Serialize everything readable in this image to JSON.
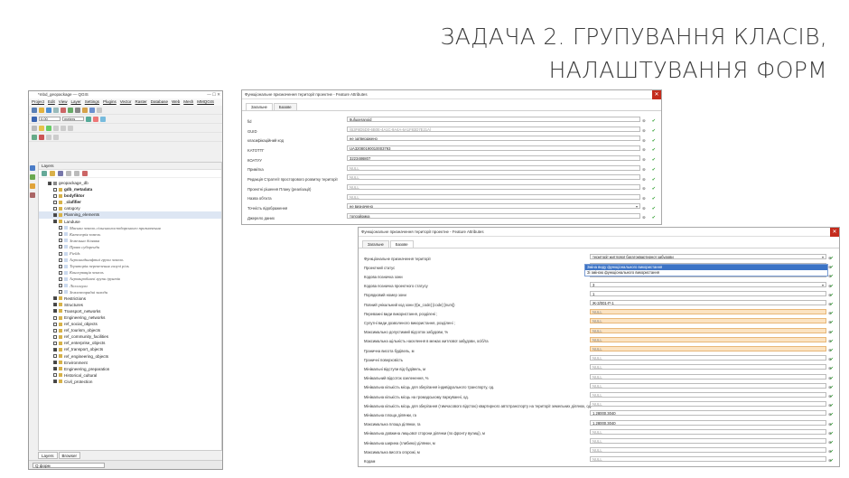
{
  "slide": {
    "title_line1": "ЗАДАЧА 2. ГРУПУВАННЯ КЛАСІВ,",
    "title_line2": "НАЛАШТУВАННЯ ФОРМ"
  },
  "qgis": {
    "window_title": "*mbd_geopackage — QGIS",
    "menu": [
      "Project",
      "Edit",
      "View",
      "Layer",
      "Settings",
      "Plugins",
      "Vector",
      "Raster",
      "Database",
      "Web",
      "Mesh",
      "MMQGIS"
    ],
    "scale_value": "0.00",
    "units_value": "meters",
    "layers_panel_title": "Layers",
    "tabs": [
      "Layers",
      "Browser"
    ],
    "search_placeholder": "Q  форм",
    "tree": [
      {
        "label": "geopackage_db",
        "indent": 1,
        "check": true,
        "style": ""
      },
      {
        "label": "gdb_metadata",
        "indent": 2,
        "check": false,
        "style": "bold"
      },
      {
        "label": "bodyfiktor",
        "indent": 2,
        "check": false,
        "style": "bold"
      },
      {
        "label": "_clafifier",
        "indent": 2,
        "check": false,
        "style": "bold"
      },
      {
        "label": "catogory",
        "indent": 2,
        "check": false,
        "style": ""
      },
      {
        "label": "Planning_elements",
        "indent": 2,
        "check": true,
        "style": "",
        "sel": true
      },
      {
        "label": "Landuse",
        "indent": 2,
        "check": true,
        "style": ""
      },
      {
        "label": "Масиви земель сільськогосподарського призначення",
        "indent": 3,
        "check": false,
        "style": "it"
      },
      {
        "label": "Категорія земель",
        "indent": 3,
        "check": false,
        "style": "it"
      },
      {
        "label": "Земельна ділянка",
        "indent": 3,
        "check": false,
        "style": "it"
      },
      {
        "label": "Право суборенди",
        "indent": 3,
        "check": false,
        "style": "it"
      },
      {
        "label": "Fields",
        "indent": 3,
        "check": false,
        "style": "it"
      },
      {
        "label": "Агроландшафтні групи земель",
        "indent": 3,
        "check": false,
        "style": "it"
      },
      {
        "label": "Територія перевезення галузі ріль",
        "indent": 3,
        "check": false,
        "style": "it"
      },
      {
        "label": "Консервація земель",
        "indent": 3,
        "check": false,
        "style": "it"
      },
      {
        "label": "Агровиробничі групи ґрунтів",
        "indent": 3,
        "check": false,
        "style": "it"
      },
      {
        "label": "Лісосмуги",
        "indent": 3,
        "check": false,
        "style": "it"
      },
      {
        "label": "Землевпорядні заходи",
        "indent": 3,
        "check": false,
        "style": "it"
      },
      {
        "label": "Restrictions",
        "indent": 2,
        "check": true,
        "style": ""
      },
      {
        "label": "Structures",
        "indent": 2,
        "check": true,
        "style": ""
      },
      {
        "label": "Transport_networks",
        "indent": 2,
        "check": true,
        "style": ""
      },
      {
        "label": "Engineering_networks",
        "indent": 2,
        "check": false,
        "style": ""
      },
      {
        "label": "ref_social_objects",
        "indent": 2,
        "check": false,
        "style": ""
      },
      {
        "label": "ref_tourism_objects",
        "indent": 2,
        "check": false,
        "style": ""
      },
      {
        "label": "ref_community_facilities",
        "indent": 2,
        "check": false,
        "style": ""
      },
      {
        "label": "ref_enterprise_objects",
        "indent": 2,
        "check": false,
        "style": ""
      },
      {
        "label": "ref_transport_objects",
        "indent": 2,
        "check": true,
        "style": ""
      },
      {
        "label": "ref_engineering_objects",
        "indent": 2,
        "check": false,
        "style": ""
      },
      {
        "label": "Environment",
        "indent": 2,
        "check": true,
        "style": ""
      },
      {
        "label": "Engineering_preparation",
        "indent": 2,
        "check": true,
        "style": ""
      },
      {
        "label": "Historical_cultural",
        "indent": 2,
        "check": false,
        "style": ""
      },
      {
        "label": "Civil_protection",
        "indent": 2,
        "check": true,
        "style": ""
      }
    ]
  },
  "form1": {
    "title": "Функціональне призначення території проектне - Feature Attributes",
    "tabs": [
      "Загальне",
      "Базове"
    ],
    "rows": [
      {
        "label": "fid",
        "value": "8ufugeranoid",
        "kind": "text"
      },
      {
        "label": "GUID",
        "value": "{B3F8D5D0-6B0E-4A1C-9A4A-6A1F83D7E21A}",
        "kind": "null"
      },
      {
        "label": "класифікаційний код",
        "value": "не затверджено",
        "kind": "text"
      },
      {
        "label": "KATOTTГ",
        "value": "UA32080190010003793",
        "kind": "text"
      },
      {
        "label": "КОАТУУ",
        "value": "3223486807",
        "kind": "text"
      },
      {
        "label": "Примітка",
        "value": "NULL",
        "kind": "null"
      },
      {
        "label": "Редакція Стратегії просторового розвитку території",
        "value": "NULL",
        "kind": "null"
      },
      {
        "label": "Проектні рішення Плану (реалізації)",
        "value": "NULL",
        "kind": "null"
      },
      {
        "label": "Назва об'єкта",
        "value": "NULL",
        "kind": "null"
      },
      {
        "label": "Точність відображення",
        "value": "не визначено",
        "kind": "dd"
      },
      {
        "label": "Джерело даних",
        "value": "топозйомка",
        "kind": "text"
      }
    ]
  },
  "form2": {
    "title": "Функціональне призначення території проектне - Feature Attributes",
    "tabs": [
      "Загальне",
      "Базове"
    ],
    "dropdown_options": [
      "Зміна виду функціонального використання",
      "Зі зміною функціонального використання"
    ],
    "rows": [
      {
        "label": "Функціональне призначення території",
        "value": "території житлової багатоквартирної забудови",
        "kind": "dd"
      },
      {
        "label": "Проектний статус",
        "value": "",
        "kind": "text"
      },
      {
        "label": "Кодова позначка зони",
        "value": "",
        "kind": "text"
      },
      {
        "label": "Кодова позначка проектного статусу",
        "value": "3",
        "kind": "dd"
      },
      {
        "label": "Порядковий номер зони",
        "value": "1",
        "kind": "text"
      },
      {
        "label": "Повний унікальний код зони (![ж_code] [code] [num])",
        "value": "Ж-3/001-Р-1",
        "kind": "text"
      },
      {
        "label": "Переважні види використання, розділені ;",
        "value": "NULL",
        "kind": "orange"
      },
      {
        "label": "Супутні види дозволеного використання, розділені ;",
        "value": "NULL",
        "kind": "orange"
      },
      {
        "label": "Максимально допустимий відсоток забудови, %",
        "value": "NULL",
        "kind": "orange"
      },
      {
        "label": "Максимальна щільність населення в межах житлової забудови, осіб/га",
        "value": "NULL",
        "kind": "orange"
      },
      {
        "label": "Гранична висота будівель, м",
        "value": "NULL",
        "kind": "orange"
      },
      {
        "label": "Граничні поверховість",
        "value": "NULL",
        "kind": "null"
      },
      {
        "label": "Мінімальні відступи від будівель, м",
        "value": "NULL",
        "kind": "null"
      },
      {
        "label": "Мінімальний відсоток озеленення, %",
        "value": "NULL",
        "kind": "null"
      },
      {
        "label": "Мінімальна кількість місць для зберігання індивідуального транспорту, од.",
        "value": "NULL",
        "kind": "null"
      },
      {
        "label": "Мінімальна кількість місць на громадському паркуванні, од.",
        "value": "NULL",
        "kind": "null"
      },
      {
        "label": "Мінімальна кількість місць для зберігання (тимчасового відстою) квартирного автотранспорту на території земельних ділянок, од.",
        "value": "NULL",
        "kind": "null"
      },
      {
        "label": "Мінімальна площа ділянки, га",
        "value": "1.28000,3040",
        "kind": "text"
      },
      {
        "label": "Максимальна площа ділянки, га",
        "value": "1.28000,3040",
        "kind": "text"
      },
      {
        "label": "Мінімальна довжина лицьової сторони ділянки (по фронту вулиці), м",
        "value": "NULL",
        "kind": "null"
      },
      {
        "label": "Мінімальна ширина (глибина) ділянки, м",
        "value": "NULL",
        "kind": "null"
      },
      {
        "label": "Максимальна висота огорожі, м",
        "value": "NULL",
        "kind": "null"
      },
      {
        "label": "Кодам",
        "value": "NULL",
        "kind": "null"
      }
    ]
  }
}
